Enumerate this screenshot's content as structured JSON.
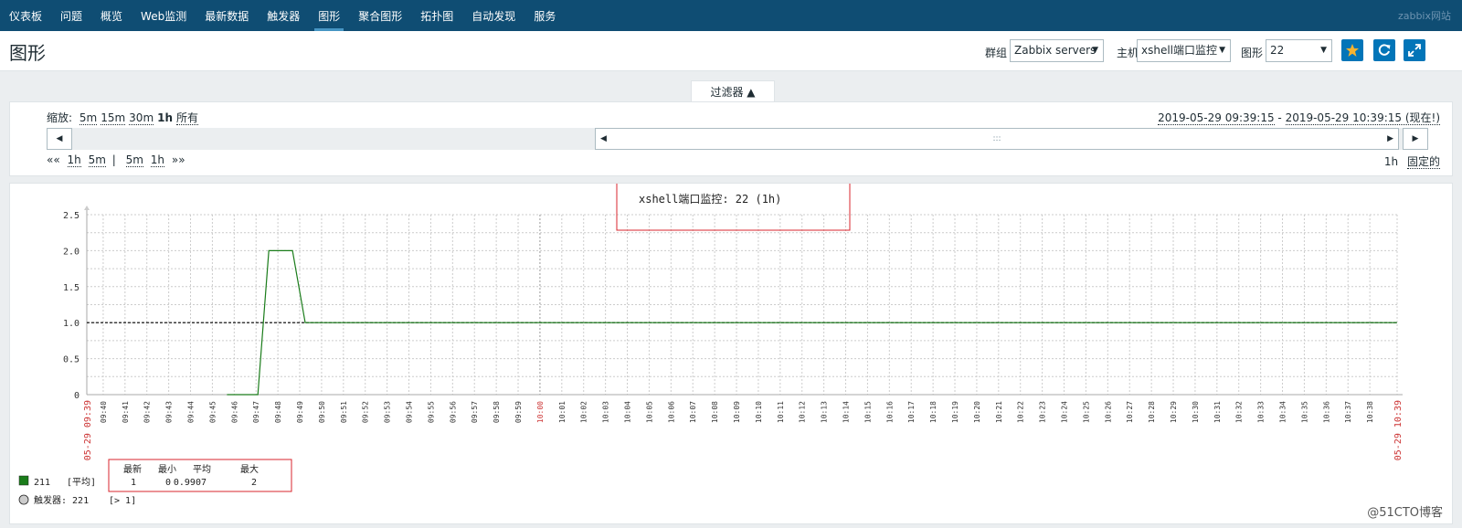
{
  "nav": {
    "items": [
      "仪表板",
      "问题",
      "概览",
      "Web监测",
      "最新数据",
      "触发器",
      "图形",
      "聚合图形",
      "拓扑图",
      "自动发现",
      "服务"
    ],
    "active_index": 6,
    "site_label": "zabbix网站"
  },
  "header": {
    "title": "图形",
    "group_label": "群组",
    "group_value": "Zabbix servers",
    "host_label": "主机",
    "host_value": "xshell端口监控",
    "graph_label": "图形",
    "graph_value": "22"
  },
  "icons": {
    "favorite": "star-icon",
    "refresh": "refresh-icon",
    "fullscreen": "fullscreen-icon"
  },
  "filter": {
    "tab_label": "过滤器 ▲",
    "zoom_label": "缩放:",
    "zoom_options": [
      "5m",
      "15m",
      "30m",
      "1h",
      "所有"
    ],
    "zoom_selected": "1h",
    "range_from": "2019-05-29 09:39:15",
    "range_sep": " - ",
    "range_to": "2019-05-29 10:39:15 (现在!)",
    "nav_back": "««",
    "nav_back_steps": [
      "1h",
      "5m"
    ],
    "nav_sep": "|",
    "nav_fwd_steps": [
      "5m",
      "1h"
    ],
    "nav_fwd": "»»",
    "period": "1h",
    "fixed_label": "固定的"
  },
  "chart_data": {
    "type": "line",
    "title": "xshell端口监控: 22 (1h)",
    "ylim": [
      0,
      2.5
    ],
    "y_ticks": [
      "0",
      "0.5",
      "1.0",
      "1.5",
      "2.0",
      "2.5"
    ],
    "x_start_label": "05-29 09:39",
    "x_end_label": "05-29 10:39",
    "x_ticks": [
      "09:40",
      "09:41",
      "09:42",
      "09:43",
      "09:44",
      "09:45",
      "09:46",
      "09:47",
      "09:48",
      "09:49",
      "09:50",
      "09:51",
      "09:52",
      "09:53",
      "09:54",
      "09:55",
      "09:56",
      "09:57",
      "09:58",
      "09:59",
      "10:00",
      "10:01",
      "10:02",
      "10:03",
      "10:04",
      "10:05",
      "10:06",
      "10:07",
      "10:08",
      "10:09",
      "10:10",
      "10:11",
      "10:12",
      "10:13",
      "10:14",
      "10:15",
      "10:16",
      "10:17",
      "10:18",
      "10:19",
      "10:20",
      "10:21",
      "10:22",
      "10:23",
      "10:24",
      "10:25",
      "10:26",
      "10:27",
      "10:28",
      "10:29",
      "10:30",
      "10:31",
      "10:32",
      "10:33",
      "10:34",
      "10:35",
      "10:36",
      "10:37",
      "10:38"
    ],
    "series": [
      {
        "name": "211",
        "color": "#1a7c1a",
        "points": [
          {
            "x": "09:45:40",
            "y": 0
          },
          {
            "x": "09:47:05",
            "y": 0
          },
          {
            "x": "09:47:35",
            "y": 2
          },
          {
            "x": "09:48:40",
            "y": 2
          },
          {
            "x": "09:49:15",
            "y": 1
          },
          {
            "x": "10:39:15",
            "y": 1
          }
        ]
      }
    ],
    "trigger_line": {
      "y": 1,
      "color": "#000000",
      "style": "dashed"
    },
    "legend": {
      "series_label": "211",
      "func": "[平均]",
      "headers": [
        "最新",
        "最小",
        "平均",
        "最大"
      ],
      "values": [
        "1",
        "0",
        "0.9907",
        "2"
      ],
      "trigger_label": "触发器: 221",
      "trigger_cond": "[> 1]"
    }
  },
  "watermark": "@51CTO博客"
}
